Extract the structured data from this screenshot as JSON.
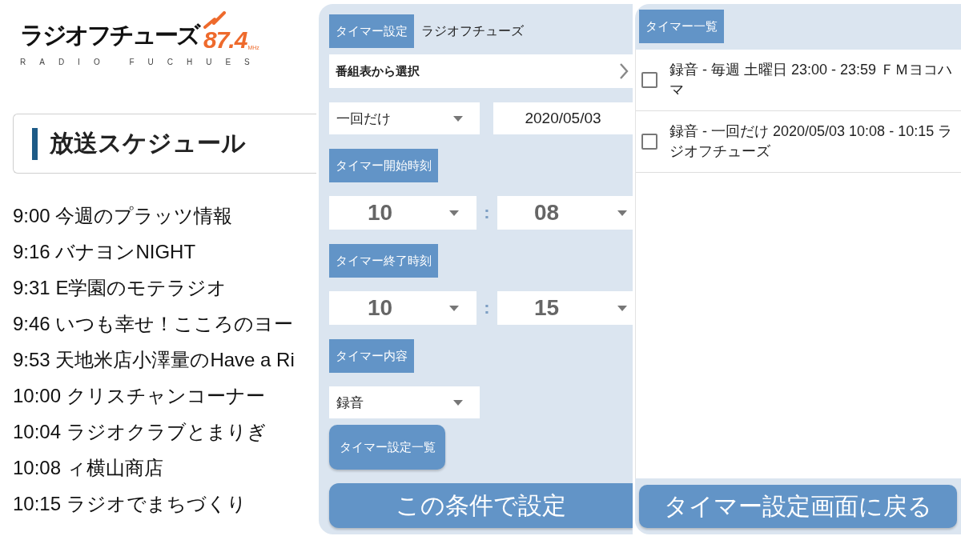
{
  "logo": {
    "name": "ラジオフチューズ",
    "frequency": "87.4",
    "unit": "MHz",
    "subtitle": "RADIO FUCHUES"
  },
  "schedule": {
    "title": "放送スケジュール",
    "items": [
      "9:00 今週のプラッツ情報",
      "9:16 バナヨンNIGHT",
      "9:31 E学園のモテラジオ",
      "9:46 いつも幸せ！こころのヨー",
      "9:53 天地米店小澤量のHave a Ri",
      "10:00 クリスチャンコーナー",
      "10:04 ラジオクラブとまりぎ",
      "10:08 ィ横山商店",
      "10:15 ラジオでまちづくり"
    ]
  },
  "timer_form": {
    "heading": "タイマー設定",
    "station": "ラジオフチューズ",
    "program_picker": "番組表から選択",
    "repeat": "一回だけ",
    "date": "2020/05/03",
    "start": {
      "label": "タイマー開始時刻",
      "hour": "10",
      "separator": ":",
      "minute": "08"
    },
    "end": {
      "label": "タイマー終了時刻",
      "hour": "10",
      "separator": ":",
      "minute": "15"
    },
    "content_label": "タイマー内容",
    "content": "録音",
    "list_button": "タイマー設定一覧",
    "submit_button": "この条件で設定"
  },
  "timer_list": {
    "heading": "タイマー一覧",
    "items": [
      {
        "text": "録音 - 毎週 土曜日 23:00 - 23:59 ＦＭヨコハマ",
        "checked": false
      },
      {
        "text": "録音 - 一回だけ 2020/05/03 10:08 - 10:15 ラジオフチューズ",
        "checked": false
      }
    ],
    "back_button": "タイマー設定画面に戻る"
  }
}
